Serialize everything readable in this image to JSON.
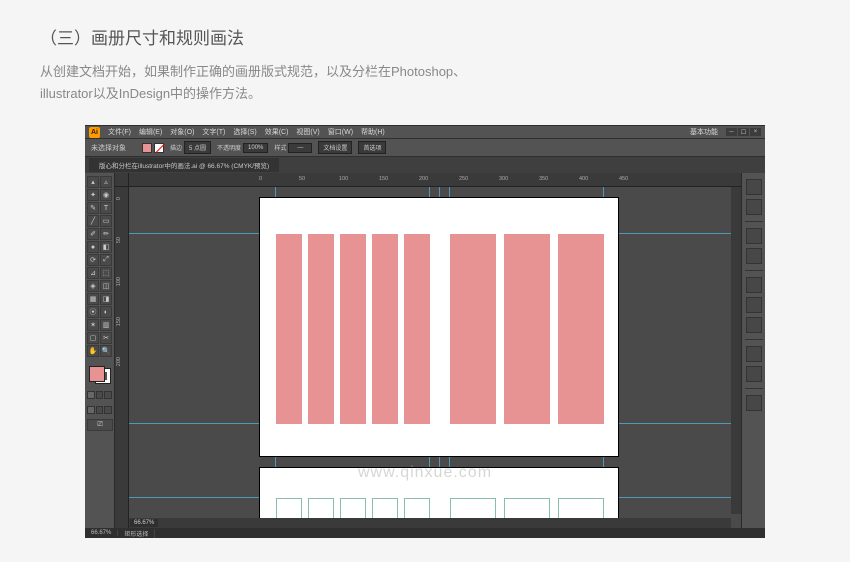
{
  "page": {
    "heading": "（三）画册尺寸和规则画法",
    "description_1": "从创建文档开始，如果制作正确的画册版式规范，以及分栏在Photoshop、",
    "description_2": "illustrator以及InDesign中的操作方法。"
  },
  "illustrator": {
    "workspace_preset": "基本功能",
    "menubar": [
      "文件(F)",
      "编辑(E)",
      "对象(O)",
      "文字(T)",
      "选择(S)",
      "效果(C)",
      "视图(V)",
      "窗口(W)",
      "帮助(H)"
    ],
    "controlbar": {
      "no_selection": "未选择对象",
      "stroke_label": "描边",
      "stroke_value": "5 点圆",
      "opacity_label": "不透明度",
      "opacity_value": "100%",
      "style_label": "样式",
      "doc_setup": "文档设置",
      "preferences": "首选项"
    },
    "document_tab": "版心和分栏在illustrator中的画法.ai @ 66.67% (CMYK/预览)",
    "ruler_h": [
      "0",
      "50",
      "100",
      "150",
      "200",
      "250",
      "300",
      "350",
      "400",
      "450"
    ],
    "ruler_v": [
      "0",
      "50",
      "100",
      "150",
      "200"
    ],
    "zoom": "66.67%",
    "statusbar_tool": "矩形选择",
    "fill_color": "#e89393",
    "watermark": "www.qinxue.com"
  }
}
